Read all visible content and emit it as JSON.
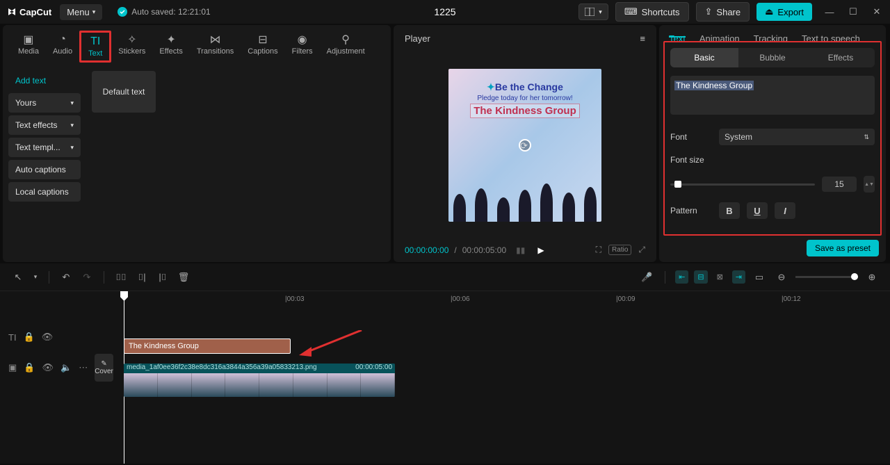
{
  "titlebar": {
    "app": "CapCut",
    "menu": "Menu",
    "autosaved": "Auto saved: 12:21:01",
    "project": "1225",
    "shortcuts": "Shortcuts",
    "share": "Share",
    "export": "Export"
  },
  "tabs": {
    "media": "Media",
    "audio": "Audio",
    "text": "Text",
    "stickers": "Stickers",
    "effects": "Effects",
    "transitions": "Transitions",
    "captions": "Captions",
    "filters": "Filters",
    "adjustment": "Adjustment"
  },
  "sidebar": {
    "add": "Add text",
    "yours": "Yours",
    "effects": "Text effects",
    "templ": "Text templ...",
    "auto": "Auto captions",
    "local": "Local captions"
  },
  "preset": "Default text",
  "player": {
    "label": "Player",
    "canvas_title": "Be the Change",
    "canvas_sub": "Pledge today for her tomorrow!",
    "canvas_text": "The Kindness Group",
    "time_current": "00:00:00:00",
    "time_total": "00:00:05:00",
    "ratio": "Ratio"
  },
  "rp": {
    "tab_text": "Text",
    "tab_anim": "Animation",
    "tab_track": "Tracking",
    "tab_tts": "Text to speech",
    "sub_basic": "Basic",
    "sub_bubble": "Bubble",
    "sub_effects": "Effects",
    "input_value": "The Kindness Group",
    "font_label": "Font",
    "font_value": "System",
    "size_label": "Font size",
    "size_value": "15",
    "pattern_label": "Pattern",
    "save": "Save as preset"
  },
  "ruler": {
    "m0": "",
    "m3": "|00:03",
    "m6": "|00:06",
    "m9": "|00:09",
    "m12": "|00:12"
  },
  "timeline": {
    "text_clip": "The Kindness Group",
    "media_name": "media_1af0ee36f2c38e8dc316a3844a356a39a05833213.png",
    "media_dur": "00:00:05:00",
    "cover": "Cover"
  }
}
